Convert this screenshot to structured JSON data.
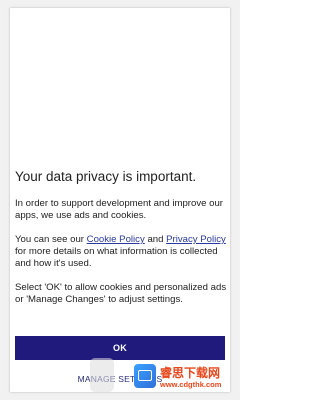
{
  "dialog": {
    "title": "Your data privacy is important.",
    "paragraph1": "In order to support development and improve our apps, we use ads and cookies.",
    "paragraph2": {
      "prefix": "You can see our ",
      "cookie_policy_link": "Cookie Policy",
      "and": " and ",
      "privacy_policy_link": "Privacy Policy",
      "suffix": " for more details on what information is collected and how it's used."
    },
    "paragraph3": "Select 'OK' to allow cookies and personalized ads or 'Manage Changes' to adjust settings.",
    "ok_label": "OK",
    "manage_label": "MANAGE SETTINGS"
  },
  "watermark": {
    "text": "睿思下载网",
    "url": "www.cdgthk.com"
  },
  "colors": {
    "primary_button": "#1f1a7c",
    "link": "#2b3aa0",
    "watermark": "#e8471c"
  }
}
